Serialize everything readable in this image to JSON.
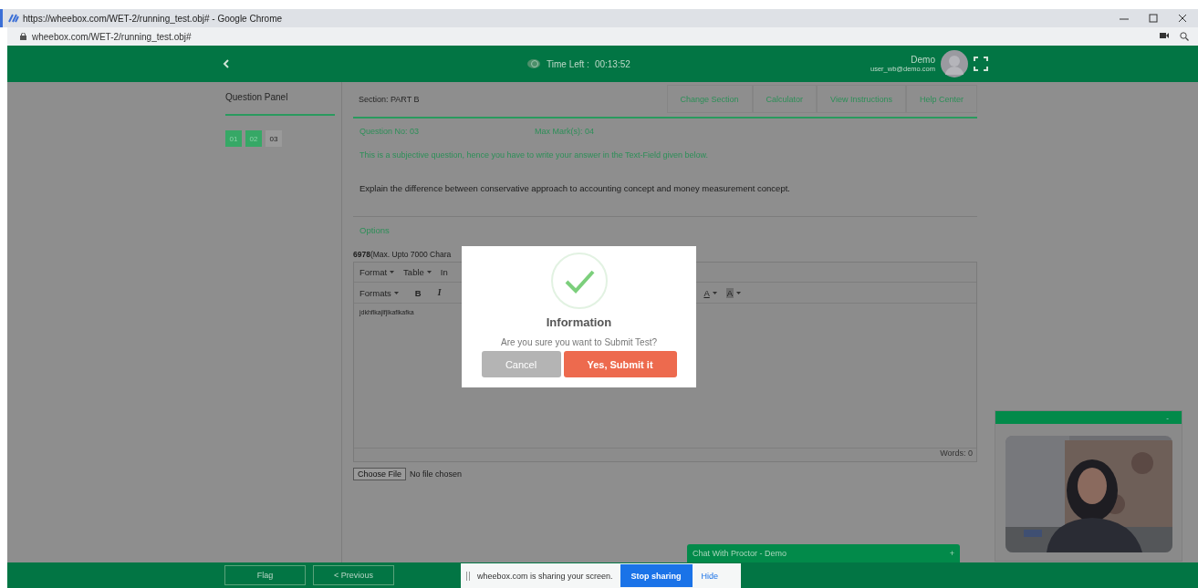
{
  "browser": {
    "title": "https://wheebox.com/WET-2/running_test.obj# - Google Chrome",
    "url": "wheebox.com/WET-2/running_test.obj#"
  },
  "header": {
    "timer_label": "Time Left :",
    "timer_value": "00:13:52",
    "user_name": "Demo",
    "user_email": "user_wb@demo.com"
  },
  "question_panel": {
    "title": "Question Panel",
    "questions": [
      {
        "number": "01",
        "answered": true
      },
      {
        "number": "02",
        "answered": true
      },
      {
        "number": "03",
        "answered": false
      }
    ]
  },
  "section": {
    "label": "Section: PART B",
    "actions": [
      "Change Section",
      "Calculator",
      "View Instructions",
      "Help Center"
    ]
  },
  "question": {
    "number": "Question No: 03",
    "max_marks": "Max Mark(s): 04",
    "instruction": "This is a subjective question, hence you have to write your answer in the Text-Field given below.",
    "text": "Explain the difference between conservative approach to accounting concept and money measurement concept.",
    "options_label": "Options"
  },
  "editor": {
    "char_count": "**6978**(Max. Upto 7000 Chara",
    "menus": [
      "Format",
      "Table",
      "In"
    ],
    "tools": [
      {
        "label": "Formats",
        "kind": "menu"
      },
      {
        "label": "B",
        "kind": "bold"
      },
      {
        "label": "I",
        "kind": "italic"
      },
      {
        "label": "A",
        "kind": "color"
      },
      {
        "label": "A",
        "kind": "highlight"
      }
    ],
    "content": "jdkhflkajlfjlkaflkafka",
    "words": "Words: 0"
  },
  "file": {
    "button": "Choose File",
    "status": "No file chosen"
  },
  "webcam": {
    "toggle": "-"
  },
  "chat": {
    "title": "Chat With Proctor - Demo",
    "toggle": "+"
  },
  "footer": {
    "buttons": [
      "Flag",
      "< Previous"
    ]
  },
  "dialog": {
    "title": "Information",
    "message": "Are you sure you want to Submit Test?",
    "buttons": [
      {
        "label": "Cancel",
        "kind": "cancel"
      },
      {
        "label": "Yes, Submit it",
        "kind": "confirm"
      }
    ]
  },
  "share_bar": {
    "message": "wheebox.com is sharing your screen.",
    "stop": "Stop sharing",
    "hide": "Hide"
  }
}
